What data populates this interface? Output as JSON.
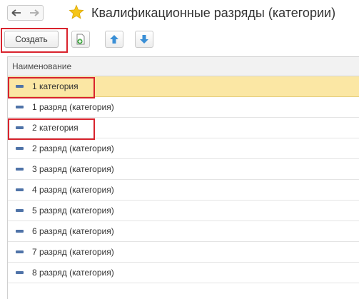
{
  "window": {
    "title": "Квалификационные разряды (категории)"
  },
  "toolbar": {
    "create_label": "Создать"
  },
  "table": {
    "column_header": "Наименование",
    "rows": [
      {
        "label": "1 категория",
        "selected": true
      },
      {
        "label": "1 разряд (категория)",
        "selected": false
      },
      {
        "label": "2 категория",
        "selected": false
      },
      {
        "label": "2 разряд (категория)",
        "selected": false
      },
      {
        "label": "3 разряд (категория)",
        "selected": false
      },
      {
        "label": "4 разряд (категория)",
        "selected": false
      },
      {
        "label": "5 разряд (категория)",
        "selected": false
      },
      {
        "label": "6 разряд (категория)",
        "selected": false
      },
      {
        "label": "7 разряд (категория)",
        "selected": false
      },
      {
        "label": "8 разряд (категория)",
        "selected": false
      }
    ]
  },
  "icons": {
    "back": "arrow-left-icon",
    "forward": "arrow-right-icon",
    "favorite": "star-icon",
    "copy": "add-copy-icon",
    "move_up": "arrow-up-icon",
    "move_down": "arrow-down-icon"
  },
  "colors": {
    "selected_row": "#fbe7a4",
    "highlight_frame": "#d9232d",
    "star": "#f5c518",
    "move_arrows": "#3a8fd6"
  }
}
